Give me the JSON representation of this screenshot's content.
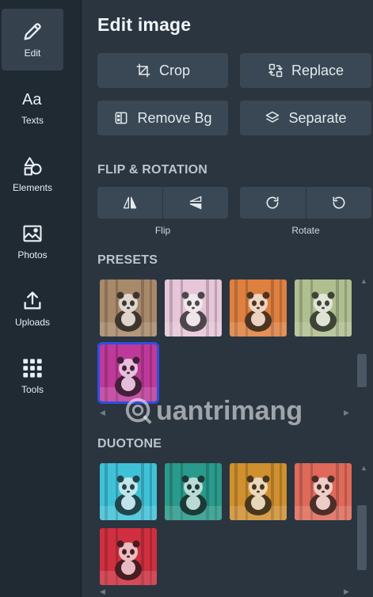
{
  "rail": {
    "items": [
      {
        "label": "Edit",
        "icon": "pencil-icon"
      },
      {
        "label": "Texts",
        "icon": "text-icon"
      },
      {
        "label": "Elements",
        "icon": "shapes-icon"
      },
      {
        "label": "Photos",
        "icon": "image-icon"
      },
      {
        "label": "Uploads",
        "icon": "upload-icon"
      },
      {
        "label": "Tools",
        "icon": "grid-icon"
      }
    ]
  },
  "panel": {
    "title": "Edit image",
    "actions": {
      "crop": "Crop",
      "replace": "Replace",
      "remove_bg": "Remove Bg",
      "separate": "Separate"
    },
    "flip_rotation": {
      "heading": "FLIP & ROTATION",
      "flip_label": "Flip",
      "rotate_label": "Rotate"
    },
    "presets": {
      "heading": "PRESETS",
      "items": [
        {
          "name": "original",
          "tint": "#a88a6a"
        },
        {
          "name": "bright",
          "tint": "#e6c6d8"
        },
        {
          "name": "warm-orange",
          "tint": "#e08040"
        },
        {
          "name": "green-purple",
          "tint": "#b0c090"
        },
        {
          "name": "magenta-night",
          "tint": "#c03a9a"
        }
      ],
      "selected_index": 4
    },
    "duotone": {
      "heading": "DUOTONE",
      "items": [
        {
          "name": "cyan-blue",
          "tint": "#3fc2d8"
        },
        {
          "name": "teal",
          "tint": "#2a9a8c"
        },
        {
          "name": "amber-brown",
          "tint": "#d09030"
        },
        {
          "name": "coral",
          "tint": "#e06a5a"
        },
        {
          "name": "red-navy",
          "tint": "#d03040"
        }
      ]
    },
    "watermark": "uantrimang"
  },
  "colors": {
    "rail_bg": "#1f2a33",
    "panel_bg": "#2a3540",
    "button_bg": "#3a4855",
    "selected_outline": "#2f4fe0"
  }
}
